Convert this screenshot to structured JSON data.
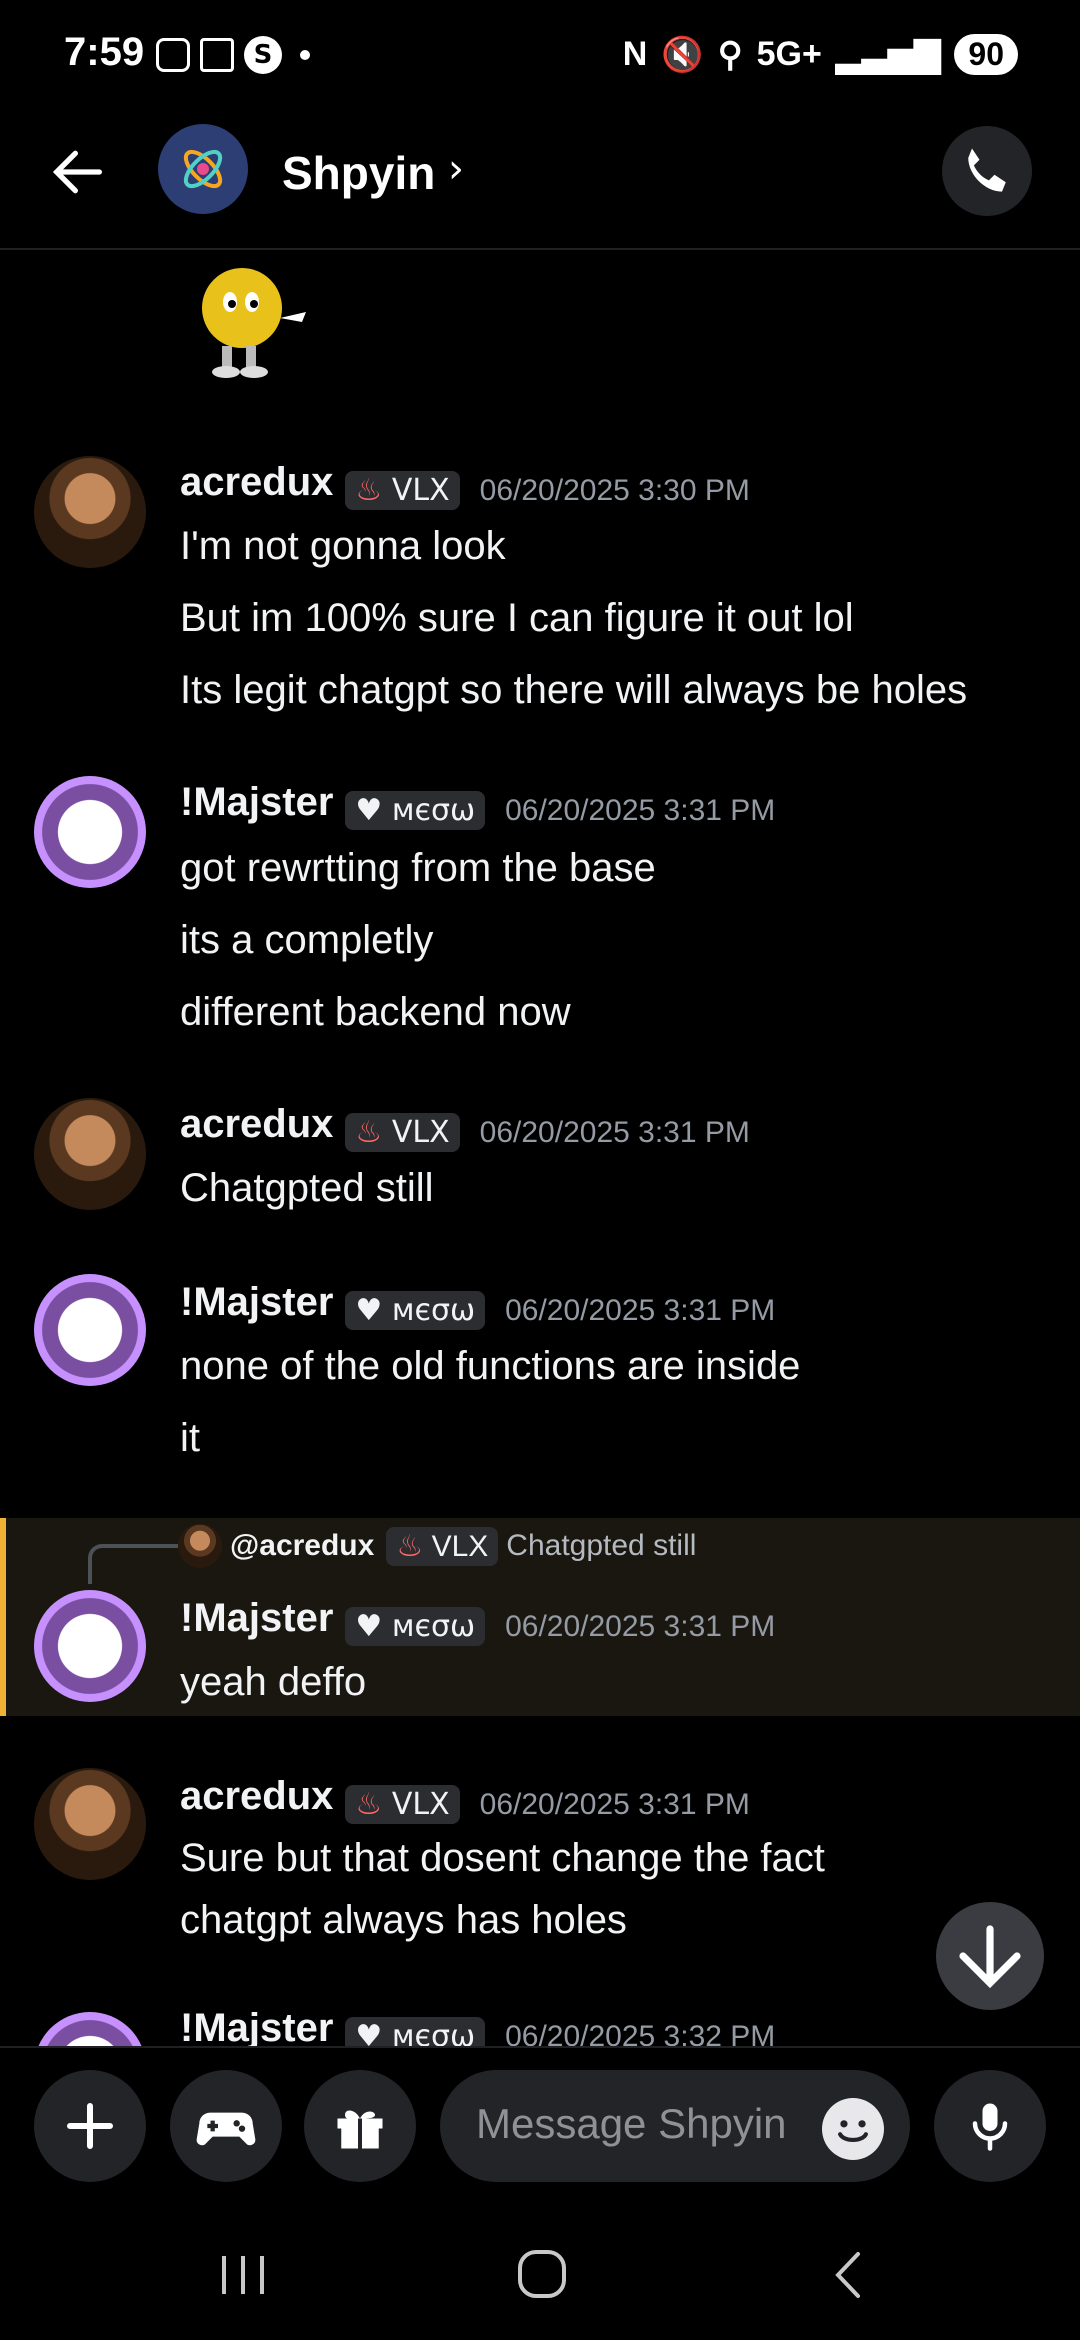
{
  "status_bar": {
    "time": "7:59",
    "network": "5G+",
    "battery": "90"
  },
  "header": {
    "title": "Shpyin",
    "chevron": "›"
  },
  "composer": {
    "placeholder": "Message Shpyin"
  },
  "messages": [
    {
      "author": "acredux",
      "tag": "VLX",
      "timestamp": "06/20/2025 3:30 PM",
      "lines": [
        "I'm not gonna look",
        "But im 100% sure I can figure it out lol",
        "Its legit chatgpt so there will always be holes"
      ]
    },
    {
      "author": "!Majster",
      "tag": "мєσω",
      "timestamp": "06/20/2025 3:31 PM",
      "lines": [
        "got rewrtting from the base",
        "its a completly",
        "different backend now"
      ]
    },
    {
      "author": "acredux",
      "tag": "VLX",
      "timestamp": "06/20/2025 3:31 PM",
      "lines": [
        "Chatgpted still"
      ]
    },
    {
      "author": "!Majster",
      "tag": "мєσω",
      "timestamp": "06/20/2025 3:31 PM",
      "lines": [
        "none of the old functions are inside",
        "it"
      ]
    },
    {
      "author": "!Majster",
      "tag": "мєσω",
      "timestamp": "06/20/2025 3:31 PM",
      "reply_to": {
        "author": "@acredux",
        "tag": "VLX",
        "text": "Chatgpted still"
      },
      "lines": [
        "yeah deffo"
      ]
    },
    {
      "author": "acredux",
      "tag": "VLX",
      "timestamp": "06/20/2025 3:31 PM",
      "lines": [
        "Sure but that dosent change the fact",
        "chatgpt always has holes"
      ]
    },
    {
      "author": "!Majster",
      "tag": "мєσω",
      "timestamp": "06/20/2025 3:32 PM",
      "lines": []
    }
  ],
  "icons": {
    "back": "arrow-left-icon",
    "call": "phone-icon",
    "add": "plus-icon",
    "games": "gamepad-icon",
    "gift": "gift-icon",
    "emoji": "emoji-icon",
    "mic": "microphone-icon",
    "scroll": "arrow-down-icon"
  },
  "colors": {
    "background": "#000000",
    "reply_highlight": "#f0b232",
    "muted_text": "#949ba4"
  }
}
